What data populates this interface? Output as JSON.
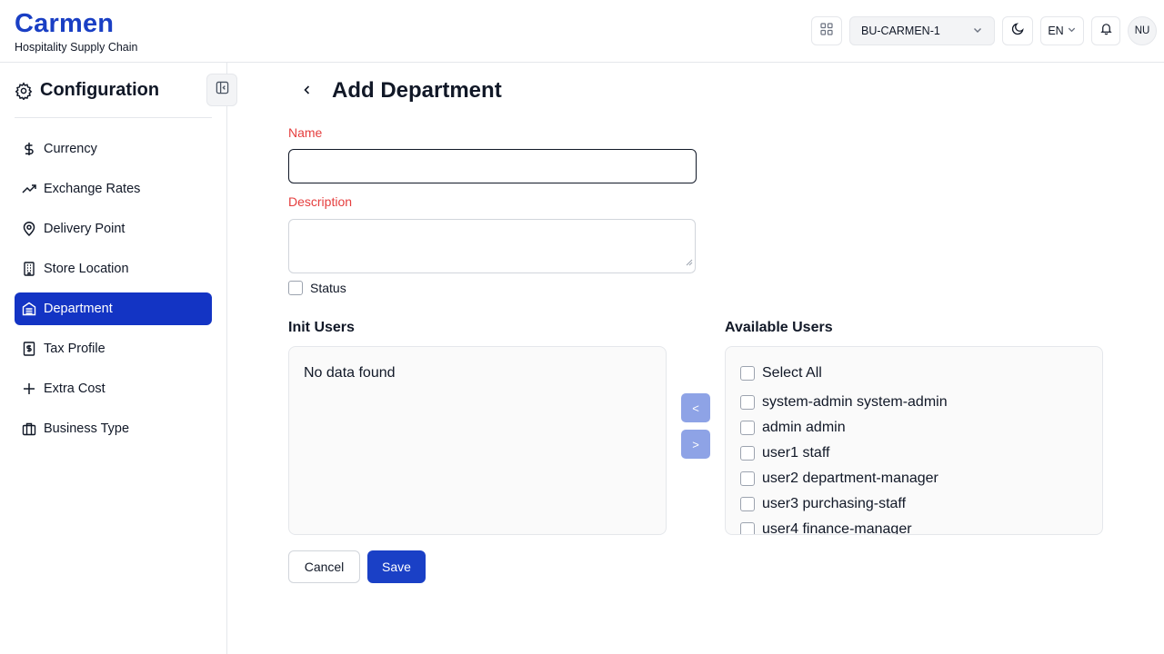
{
  "header": {
    "brand_title": "Carmen",
    "brand_subtitle": "Hospitality Supply Chain",
    "business_unit": "BU-CARMEN-1",
    "language": "EN",
    "avatar_initials": "NU"
  },
  "sidebar": {
    "title": "Configuration",
    "items": [
      {
        "label": "Currency",
        "icon": "dollar-icon"
      },
      {
        "label": "Exchange Rates",
        "icon": "trending-up-icon"
      },
      {
        "label": "Delivery Point",
        "icon": "map-pin-icon"
      },
      {
        "label": "Store Location",
        "icon": "building-icon"
      },
      {
        "label": "Department",
        "icon": "department-icon",
        "active": true
      },
      {
        "label": "Tax Profile",
        "icon": "receipt-icon"
      },
      {
        "label": "Extra Cost",
        "icon": "plus-icon"
      },
      {
        "label": "Business Type",
        "icon": "briefcase-icon"
      }
    ]
  },
  "form": {
    "title": "Add Department",
    "name_label": "Name",
    "name_value": "",
    "description_label": "Description",
    "description_value": "",
    "status_label": "Status",
    "status_checked": false
  },
  "init_users": {
    "label": "Init Users",
    "empty_text": "No data found"
  },
  "available_users": {
    "label": "Available Users",
    "select_all_label": "Select All",
    "users": [
      "system-admin system-admin",
      "admin admin",
      "user1 staff",
      "user2 department-manager",
      "user3 purchasing-staff",
      "user4 finance-manager"
    ]
  },
  "transfer": {
    "move_left_label": "<",
    "move_right_label": ">"
  },
  "actions": {
    "cancel_label": "Cancel",
    "save_label": "Save"
  },
  "colors": {
    "brand": "#1a3fc4",
    "active_nav": "#1334c4",
    "required_label": "#e53e3e",
    "transfer_button": "#8ea3e6"
  }
}
